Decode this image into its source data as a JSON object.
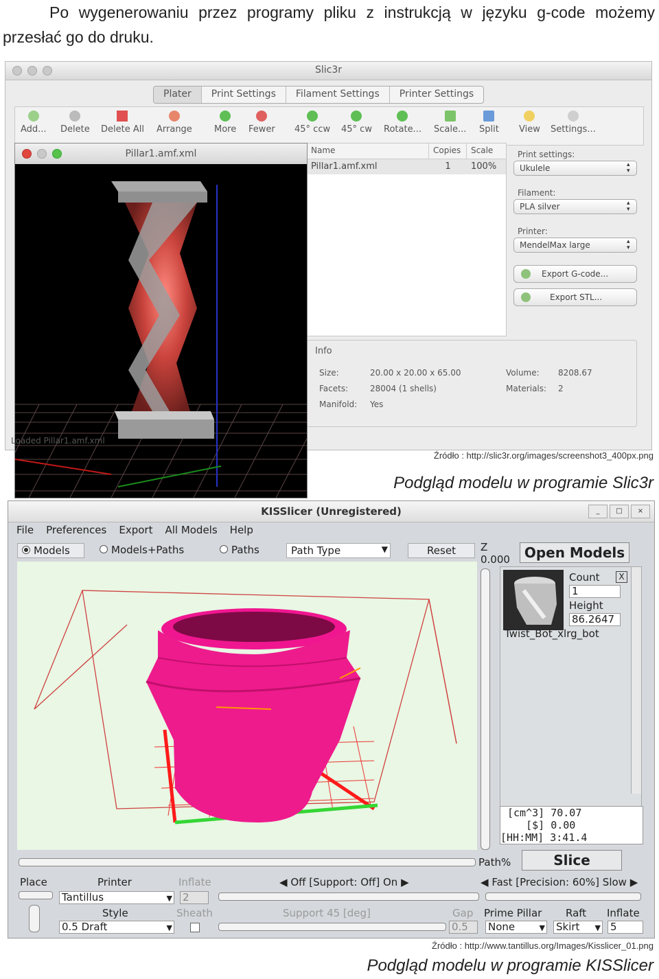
{
  "intro": {
    "line1": "Po wygenerowaniu przez programy pliku z instrukcją w języku g-code możemy",
    "line2": "przesłać go do druku."
  },
  "slic3r": {
    "window_title": "Slic3r",
    "tabs": [
      "Plater",
      "Print Settings",
      "Filament Settings",
      "Printer Settings"
    ],
    "toolbar": [
      "Add...",
      "Delete",
      "Delete All",
      "Arrange",
      "More",
      "Fewer",
      "45° ccw",
      "45° cw",
      "Rotate...",
      "Scale...",
      "Split",
      "View",
      "Settings..."
    ],
    "preview_title": "Pillar1.amf.xml",
    "list_headers": {
      "name": "Name",
      "copies": "Copies",
      "scale": "Scale"
    },
    "list_row": {
      "name": "Pillar1.amf.xml",
      "copies": "1",
      "scale": "100%"
    },
    "print_settings_label": "Print settings:",
    "print_settings_value": "Ukulele",
    "filament_label": "Filament:",
    "filament_value": "PLA silver",
    "printer_label": "Printer:",
    "printer_value": "MendelMax large",
    "export_gcode": "Export G-code...",
    "export_stl": "Export STL...",
    "info_label": "Info",
    "size_label": "Size:",
    "size_value": "20.00 x 20.00 x 65.00",
    "facets_label": "Facets:",
    "facets_value": "28004 (1 shells)",
    "manifold_label": "Manifold:",
    "manifold_value": "Yes",
    "volume_label": "Volume:",
    "volume_value": "8208.67",
    "materials_label": "Materials:",
    "materials_value": "2",
    "status": "Loaded Pillar1.amf.xml"
  },
  "caption1_source": "Źródło : http://slic3r.org/images/screenshot3_400px.png",
  "caption1_title": "Podgląd modelu w programie Slic3r",
  "kisslicer": {
    "window_title": "KISSlicer (Unregistered)",
    "window_buttons": [
      "_",
      "□",
      "×"
    ],
    "menu": [
      "File",
      "Preferences",
      "Export",
      "All Models",
      "Help"
    ],
    "view_models": "Models",
    "view_models_paths": "Models+Paths",
    "view_paths": "Paths",
    "path_type": "Path Type",
    "reset": "Reset",
    "z_label": "Z",
    "z_value": "0.000",
    "open_models": "Open Models",
    "count_label": "Count",
    "count_value": "1",
    "height_label": "Height",
    "height_value": "86.2647",
    "model_name": "Twist_Bot_xlrg_bot",
    "stats": [
      "[cm^3] 70.07",
      "   [$] 0.00",
      "[HH:MM] 3:41.4"
    ],
    "path_pct": "Path%",
    "slice": "Slice",
    "place": "Place",
    "printer_label": "Printer",
    "printer_value": "Tantillus",
    "inflate_label": "Inflate",
    "inflate_value": "2",
    "support_toggle": "Off [Support: Off] On",
    "precision_toggle": "Fast [Precision: 60%] Slow",
    "style_label": "Style",
    "style_value": "0.5 Draft",
    "sheath_label": "Sheath",
    "support_label": "Support 45 [deg]",
    "gap_label": "Gap",
    "gap_value": "0.5",
    "prime_pillar_label": "Prime Pillar",
    "prime_pillar_value": "None",
    "raft_label": "Raft",
    "raft_value": "Skirt",
    "inflate2_label": "Inflate",
    "inflate2_value": "5"
  },
  "caption2_source": "Źródło : http://www.tantillus.org/Images/Kisslicer_01.png",
  "caption2_title": "Podgląd modelu w programie KISSlicer"
}
